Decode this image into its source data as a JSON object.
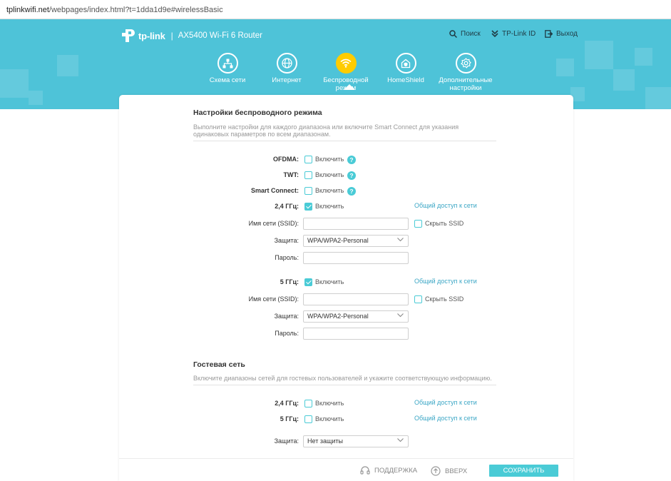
{
  "browser": {
    "url_host": "tplinkwifi.net",
    "url_rest": "/webpages/index.html?t=1dda1d9e#wirelessBasic"
  },
  "header": {
    "brand": "tp-link",
    "model": "AX5400 Wi-Fi 6 Router",
    "top_links": {
      "search": "Поиск",
      "tplink_id": "TP-Link ID",
      "logout": "Выход"
    },
    "nav": [
      {
        "label": "Схема сети",
        "icon": "network-map-icon"
      },
      {
        "label": "Интернет",
        "icon": "globe-icon"
      },
      {
        "label": "Беспроводной режим",
        "icon": "wifi-icon",
        "active": true
      },
      {
        "label": "HomeShield",
        "icon": "homeshield-icon"
      },
      {
        "label": "Дополнительные настройки",
        "icon": "gear-icon"
      }
    ],
    "colors": {
      "band": "#4ec3d8",
      "active": "#ffcc00",
      "accent": "#4acbd6"
    }
  },
  "wireless": {
    "title": "Настройки беспроводного режима",
    "description": "Выполните настройки для каждого диапазона или включите Smart Connect для указания одинаковых параметров по всем диапазонам.",
    "enable_text": "Включить",
    "ofdma": {
      "label": "OFDMA:",
      "checked": false
    },
    "twt": {
      "label": "TWT:",
      "checked": false
    },
    "smart_connect": {
      "label": "Smart Connect:",
      "checked": false
    },
    "band24": {
      "label": "2,4 ГГц:",
      "checked": true,
      "share_link": "Общий доступ к сети",
      "ssid_label": "Имя сети (SSID):",
      "ssid_value": "",
      "hide_ssid": "Скрыть SSID",
      "security_label": "Защита:",
      "security_value": "WPA/WPA2-Personal",
      "password_label": "Пароль:",
      "password_value": ""
    },
    "band5": {
      "label": "5 ГГц:",
      "checked": true,
      "share_link": "Общий доступ к сети",
      "ssid_label": "Имя сети (SSID):",
      "ssid_value": "",
      "hide_ssid": "Скрыть SSID",
      "security_label": "Защита:",
      "security_value": "WPA/WPA2-Personal",
      "password_label": "Пароль:",
      "password_value": ""
    }
  },
  "guest": {
    "title": "Гостевая сеть",
    "description": "Включите диапазоны сетей для гостевых пользователей и укажите соответствующую информацию.",
    "band24": {
      "label": "2,4 ГГц:",
      "checked": false,
      "share_link": "Общий доступ к сети"
    },
    "band5": {
      "label": "5 ГГц:",
      "checked": false,
      "share_link": "Общий доступ к сети"
    },
    "security_label": "Защита:",
    "security_value": "Нет защиты"
  },
  "footer": {
    "support": "ПОДДЕРЖКА",
    "top": "ВВЕРХ",
    "save": "СОХРАНИТЬ"
  }
}
